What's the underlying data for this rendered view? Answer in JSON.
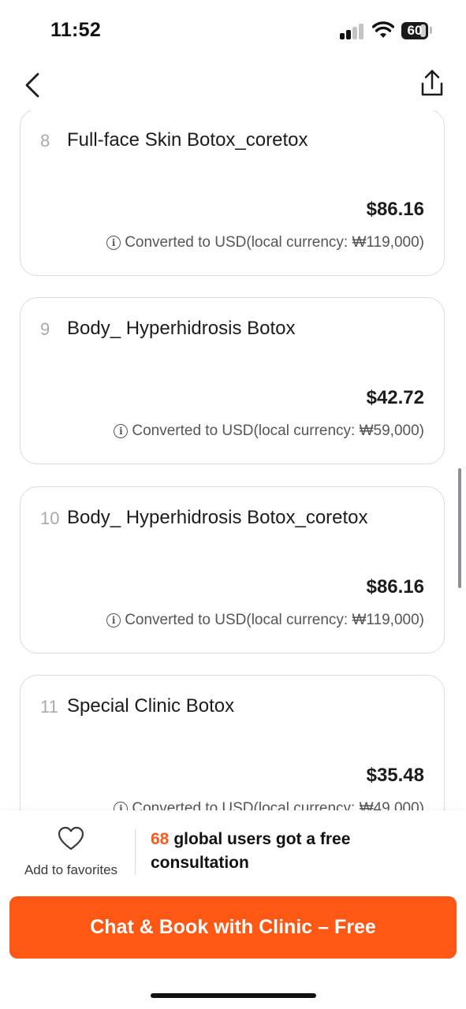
{
  "status_bar": {
    "time": "11:52",
    "battery": "60"
  },
  "nav": {
    "back_icon": "chevron-left-icon",
    "share_icon": "share-icon"
  },
  "items": [
    {
      "number": "8",
      "title": "Full-face Skin Botox_coretox",
      "price": "$86.16",
      "note": "Converted to USD(local currency: ₩119,000)"
    },
    {
      "number": "9",
      "title": "Body_ Hyperhidrosis Botox",
      "price": "$42.72",
      "note": "Converted to USD(local currency: ₩59,000)"
    },
    {
      "number": "10",
      "title": "Body_ Hyperhidrosis Botox_coretox",
      "price": "$86.16",
      "note": "Converted to USD(local currency: ₩119,000)"
    },
    {
      "number": "11",
      "title": "Special Clinic Botox",
      "price": "$35.48",
      "note": "Converted to USD(local currency: ₩49,000)"
    }
  ],
  "bottom": {
    "favorite_label": "Add to favorites",
    "consult_count": "68",
    "consult_text": "global users got a free consultation",
    "cta_label": "Chat & Book with Clinic – Free"
  },
  "colors": {
    "accent": "#ff5714",
    "count": "#ff5a1f"
  }
}
